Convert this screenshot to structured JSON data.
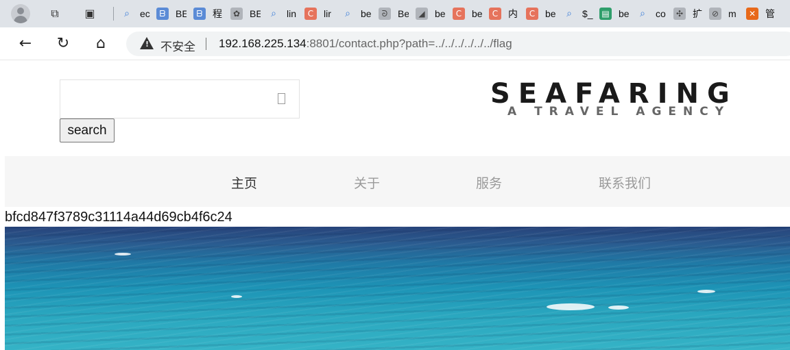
{
  "browser": {
    "tabs": [
      {
        "favicon": "search-icon",
        "label": "ec"
      },
      {
        "favicon": "b-icon",
        "label": "BE"
      },
      {
        "favicon": "b-icon",
        "label": "程"
      },
      {
        "favicon": "flower-icon",
        "label": "BE"
      },
      {
        "favicon": "search-icon",
        "label": "lin"
      },
      {
        "favicon": "c-icon",
        "label": "lir"
      },
      {
        "favicon": "search-icon",
        "label": "be"
      },
      {
        "favicon": "bird-icon",
        "label": "Be"
      },
      {
        "favicon": "triangle-icon",
        "label": "be"
      },
      {
        "favicon": "c-icon",
        "label": "be"
      },
      {
        "favicon": "c-icon",
        "label": "内"
      },
      {
        "favicon": "c-icon",
        "label": "be"
      },
      {
        "favicon": "search-icon",
        "label": "$_"
      },
      {
        "favicon": "sheet-icon",
        "label": "be"
      },
      {
        "favicon": "search-icon",
        "label": "co"
      },
      {
        "favicon": "puzzle-icon",
        "label": "扩"
      },
      {
        "favicon": "blocked-icon",
        "label": "m"
      },
      {
        "favicon": "xampp-icon",
        "label": "管"
      }
    ],
    "address": {
      "security_label": "不安全",
      "url_host": "192.168.225.134",
      "url_rest": ":8801/contact.php?path=../../../../../../flag"
    }
  },
  "page": {
    "search": {
      "placeholder": "",
      "button_label": "search"
    },
    "logo": {
      "title": "SEAFARING",
      "subtitle": "A TRAVEL AGENCY"
    },
    "menu": [
      {
        "label": "主页",
        "active": true
      },
      {
        "label": "关于",
        "active": false
      },
      {
        "label": "服务",
        "active": false
      },
      {
        "label": "联系我们",
        "active": false
      }
    ],
    "output_text": "bfcd847f3789c31114a44d69cb4f6c24"
  },
  "colors": {
    "accent_dark": "#1a1a1a",
    "menu_active": "#333333",
    "menu_inactive": "#9a9a9a",
    "ocean_deep": "#27437a",
    "ocean_light": "#35b3c6"
  }
}
